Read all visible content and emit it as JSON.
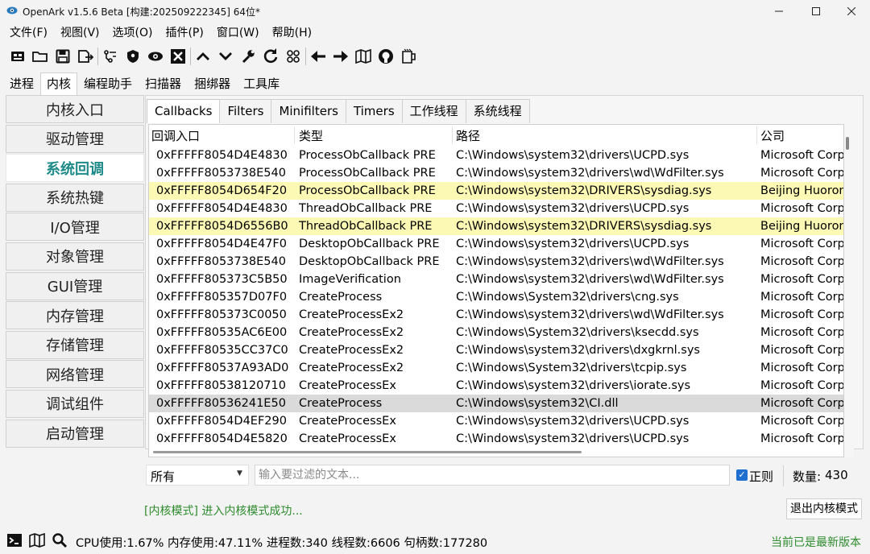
{
  "window": {
    "title": "OpenArk v1.5.6 Beta [构建:202509222345]  64位*"
  },
  "menu": [
    "文件(F)",
    "视图(V)",
    "选项(O)",
    "插件(P)",
    "窗口(W)",
    "帮助(H)"
  ],
  "main_tabs": [
    "进程",
    "内核",
    "编程助手",
    "扫描器",
    "捆绑器",
    "工具库"
  ],
  "sidebar": [
    "内核入口",
    "驱动管理",
    "系统回调",
    "系统热键",
    "I/O管理",
    "对象管理",
    "GUI管理",
    "内存管理",
    "存储管理",
    "网络管理",
    "调试组件",
    "启动管理"
  ],
  "sub_tabs": [
    "Callbacks",
    "Filters",
    "Minifilters",
    "Timers",
    "工作线程",
    "系统线程"
  ],
  "table": {
    "columns": [
      "回调入口",
      "类型",
      "路径",
      "公司"
    ],
    "rows": [
      [
        "0xFFFFF8054D4E4830",
        "ProcessObCallback PRE",
        "C:\\Windows\\system32\\drivers\\UCPD.sys",
        "Microsoft Corp"
      ],
      [
        "0xFFFFF8053738E540",
        "ProcessObCallback PRE",
        "C:\\Windows\\system32\\drivers\\wd\\WdFilter.sys",
        "Microsoft Corp"
      ],
      [
        "0xFFFFF8054D654F20",
        "ProcessObCallback PRE",
        "C:\\Windows\\system32\\DRIVERS\\sysdiag.sys",
        "Beijing Huoron"
      ],
      [
        "0xFFFFF8054D4E4830",
        "ThreadObCallback PRE",
        "C:\\Windows\\system32\\drivers\\UCPD.sys",
        "Microsoft Corp"
      ],
      [
        "0xFFFFF8054D6556B0",
        "ThreadObCallback PRE",
        "C:\\Windows\\system32\\DRIVERS\\sysdiag.sys",
        "Beijing Huoron"
      ],
      [
        "0xFFFFF8054D4E47F0",
        "DesktopObCallback PRE",
        "C:\\Windows\\system32\\drivers\\UCPD.sys",
        "Microsoft Corp"
      ],
      [
        "0xFFFFF8053738E540",
        "DesktopObCallback PRE",
        "C:\\Windows\\system32\\drivers\\wd\\WdFilter.sys",
        "Microsoft Corp"
      ],
      [
        "0xFFFFF805373C5B50",
        "ImageVerification",
        "C:\\Windows\\system32\\drivers\\wd\\WdFilter.sys",
        "Microsoft Corp"
      ],
      [
        "0xFFFFF805357D07F0",
        "CreateProcess",
        "C:\\Windows\\System32\\drivers\\cng.sys",
        "Microsoft Corp"
      ],
      [
        "0xFFFFF805373C0050",
        "CreateProcessEx2",
        "C:\\Windows\\system32\\drivers\\wd\\WdFilter.sys",
        "Microsoft Corp"
      ],
      [
        "0xFFFFF80535AC6E00",
        "CreateProcessEx2",
        "C:\\Windows\\System32\\drivers\\ksecdd.sys",
        "Microsoft Corp"
      ],
      [
        "0xFFFFF80535CC37C0",
        "CreateProcessEx2",
        "C:\\Windows\\system32\\drivers\\dxgkrnl.sys",
        "Microsoft Corp"
      ],
      [
        "0xFFFFF80537A93AD0",
        "CreateProcessEx2",
        "C:\\Windows\\System32\\drivers\\tcpip.sys",
        "Microsoft Corp"
      ],
      [
        "0xFFFFF80538120710",
        "CreateProcessEx",
        "C:\\Windows\\system32\\drivers\\iorate.sys",
        "Microsoft Corp"
      ],
      [
        "0xFFFFF80536241E50",
        "CreateProcess",
        "C:\\Windows\\system32\\CI.dll",
        "Microsoft Corp"
      ],
      [
        "0xFFFFF8054D4EF290",
        "CreateProcessEx",
        "C:\\Windows\\system32\\drivers\\UCPD.sys",
        "Microsoft Corp"
      ],
      [
        "0xFFFFF8054D4E5820",
        "CreateProcessEx",
        "C:\\Windows\\system32\\drivers\\UCPD.sys",
        "Microsoft Corp"
      ]
    ],
    "highlighted_rows": [
      2,
      4
    ],
    "selected_row": 14,
    "highlight_color": "#fcf9b4"
  },
  "filter": {
    "scope": "所有",
    "placeholder": "输入要过滤的文本...",
    "value": "",
    "regex_label": "正则",
    "regex_checked": true,
    "count_label": "数量:",
    "count": "430"
  },
  "mode_status": "[内核模式] 进入内核模式成功...",
  "exit_kernel_button": "退出内核模式",
  "statusbar": {
    "stats": "CPU使用:1.67% 内存使用:47.11% 进程数:340 线程数:6606 句柄数:177280",
    "version_status": "当前已是最新版本"
  },
  "colors": {
    "active_sidebar": "#1f8a8a",
    "status_green": "#2e8b2e",
    "checkbox_blue": "#1f6fd1"
  },
  "icons": {
    "toolbar": [
      "console-icon",
      "open-folder-icon",
      "save-icon",
      "export-icon",
      "list-icon",
      "shield-icon",
      "eye-icon",
      "close-box-icon",
      "chevron-up-icon",
      "chevron-down-icon",
      "wrench-icon",
      "refresh-icon",
      "grid-icon",
      "arrow-left-icon",
      "arrow-right-icon",
      "map-icon",
      "github-icon",
      "mug-icon"
    ],
    "statusbar": [
      "terminal-icon",
      "map-icon",
      "search-icon"
    ]
  }
}
